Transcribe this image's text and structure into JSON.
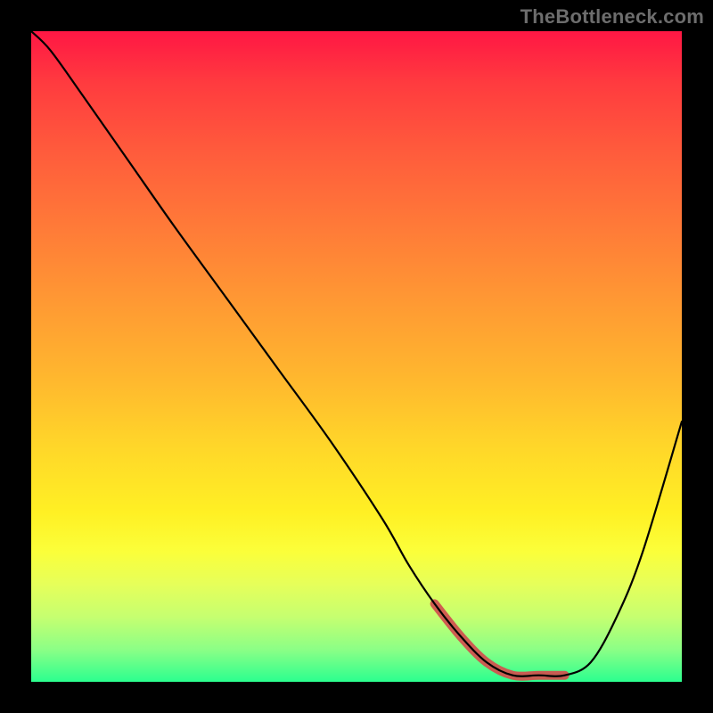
{
  "watermark": "TheBottleneck.com",
  "chart_data": {
    "type": "line",
    "title": "",
    "xlabel": "",
    "ylabel": "",
    "xlim": [
      0,
      100
    ],
    "ylim": [
      0,
      100
    ],
    "series": [
      {
        "name": "curve",
        "x": [
          0,
          3,
          8,
          15,
          22,
          30,
          38,
          46,
          54,
          58,
          62,
          66,
          70,
          74,
          78,
          82,
          86,
          90,
          94,
          100
        ],
        "values": [
          100,
          97,
          90,
          80,
          70,
          59,
          48,
          37,
          25,
          18,
          12,
          7,
          3,
          1,
          1,
          1,
          3,
          10,
          20,
          40
        ]
      }
    ],
    "annotations": [
      {
        "name": "bottom-band",
        "x_start": 62,
        "x_end": 82,
        "purpose": "highlighted valley segment"
      }
    ],
    "background": {
      "type": "vertical-gradient",
      "stops": [
        {
          "pos": 0.0,
          "color": "#ff1744"
        },
        {
          "pos": 0.3,
          "color": "#ff7a38"
        },
        {
          "pos": 0.64,
          "color": "#ffd729"
        },
        {
          "pos": 0.85,
          "color": "#e6ff5a"
        },
        {
          "pos": 1.0,
          "color": "#2bff8f"
        }
      ]
    }
  }
}
